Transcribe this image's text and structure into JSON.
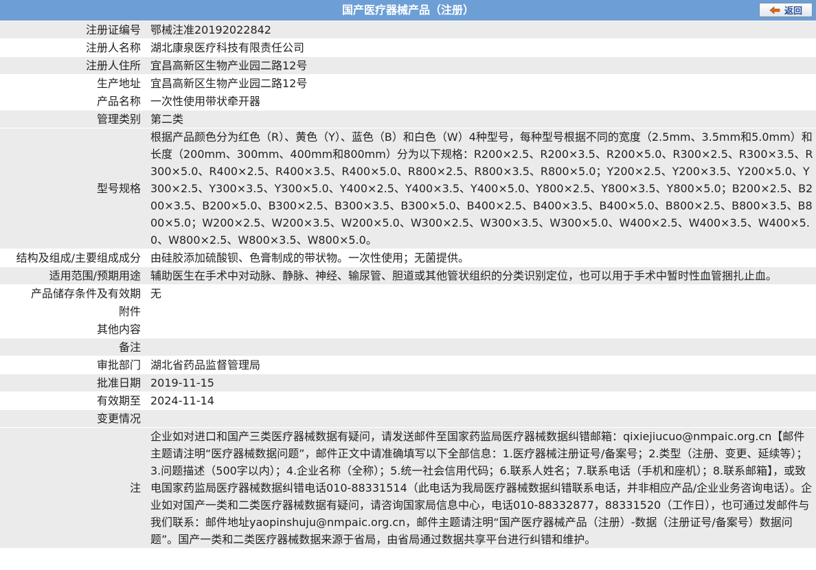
{
  "header": {
    "title": "国产医疗器械产品（注册）",
    "back_label": "返回"
  },
  "rows": [
    {
      "label": "注册证编号",
      "value": "鄂械注准20192022842"
    },
    {
      "label": "注册人名称",
      "value": "湖北康泉医疗科技有限责任公司"
    },
    {
      "label": "注册人住所",
      "value": "宜昌高新区生物产业园二路12号"
    },
    {
      "label": "生产地址",
      "value": "宜昌高新区生物产业园二路12号"
    },
    {
      "label": "产品名称",
      "value": "一次性使用带状牵开器"
    },
    {
      "label": "管理类别",
      "value": "第二类"
    },
    {
      "label": "型号规格",
      "value": "根据产品颜色分为红色（R）、黄色（Y）、蓝色（B）和白色（W）4种型号，每种型号根据不同的宽度（2.5mm、3.5mm和5.0mm）和长度（200mm、300mm、400mm和800mm）分为以下规格：R200×2.5、R200×3.5、R200×5.0、R300×2.5、R300×3.5、R300×5.0、R400×2.5、R400×3.5、R400×5.0、R800×2.5、R800×3.5、R800×5.0；Y200×2.5、Y200×3.5、Y200×5.0、Y300×2.5、Y300×3.5、Y300×5.0、Y400×2.5、Y400×3.5、Y400×5.0、Y800×2.5、Y800×3.5、Y800×5.0；B200×2.5、B200×3.5、B200×5.0、B300×2.5、B300×3.5、B300×5.0、B400×2.5、B400×3.5、B400×5.0、B800×2.5、B800×3.5、B800×5.0；W200×2.5、W200×3.5、W200×5.0、W300×2.5、W300×3.5、W300×5.0、W400×2.5、W400×3.5、W400×5.0、W800×2.5、W800×3.5、W800×5.0。"
    },
    {
      "label": "结构及组成/主要组成成分",
      "value": "由硅胶添加硫酸钡、色膏制成的带状物。一次性使用；无菌提供。"
    },
    {
      "label": "适用范围/预期用途",
      "value": "辅助医生在手术中对动脉、静脉、神经、输尿管、胆道或其他管状组织的分类识别定位，也可以用于手术中暂时性血管捆扎止血。"
    },
    {
      "label": "产品储存条件及有效期",
      "value": "无"
    },
    {
      "label": "附件",
      "value": ""
    },
    {
      "label": "其他内容",
      "value": ""
    },
    {
      "label": "备注",
      "value": ""
    },
    {
      "label": "审批部门",
      "value": "湖北省药品监督管理局"
    },
    {
      "label": "批准日期",
      "value": "2019-11-15"
    },
    {
      "label": "有效期至",
      "value": "2024-11-14"
    },
    {
      "label": "变更情况",
      "value": ""
    }
  ],
  "note": {
    "label": "注",
    "text": "企业如对进口和国产三类医疗器械数据有疑问，请发送邮件至国家药监局医疗器械数据纠错邮箱：qixiejiucuo@nmpaic.org.cn【邮件主题请注明“医疗器械数据问题”，邮件正文中请准确填写以下全部信息：1.医疗器械注册证号/备案号；2.类型（注册、变更、延续等）；3.问题描述（500字以内）；4.企业名称（全称）；5.统一社会信用代码；6.联系人姓名；7.联系电话（手机和座机）；8.联系邮箱】，或致电国家药监局医疗器械数据纠错电话010-88331514（此电话为我局医疗器械数据纠错联系电话，并非相应产品/企业业务咨询电话）。企业如对国产一类和二类医疗器械数据有疑问，请咨询国家局信息中心，电话010-88332877，88331520（工作日），也可通过发邮件与我们联系：邮件地址yaopinshuju@nmpaic.org.cn，邮件主题请注明“国产医疗器械产品（注册）-数据（注册证号/备案号）数据问题”。国产一类和二类医疗器械数据来源于省局，由省局通过数据共享平台进行纠错和维护。"
  },
  "colors": {
    "header_bg": "#6d9fd6",
    "row_alt_bg": "#ebebeb",
    "back_label": "#2a4e9a"
  }
}
